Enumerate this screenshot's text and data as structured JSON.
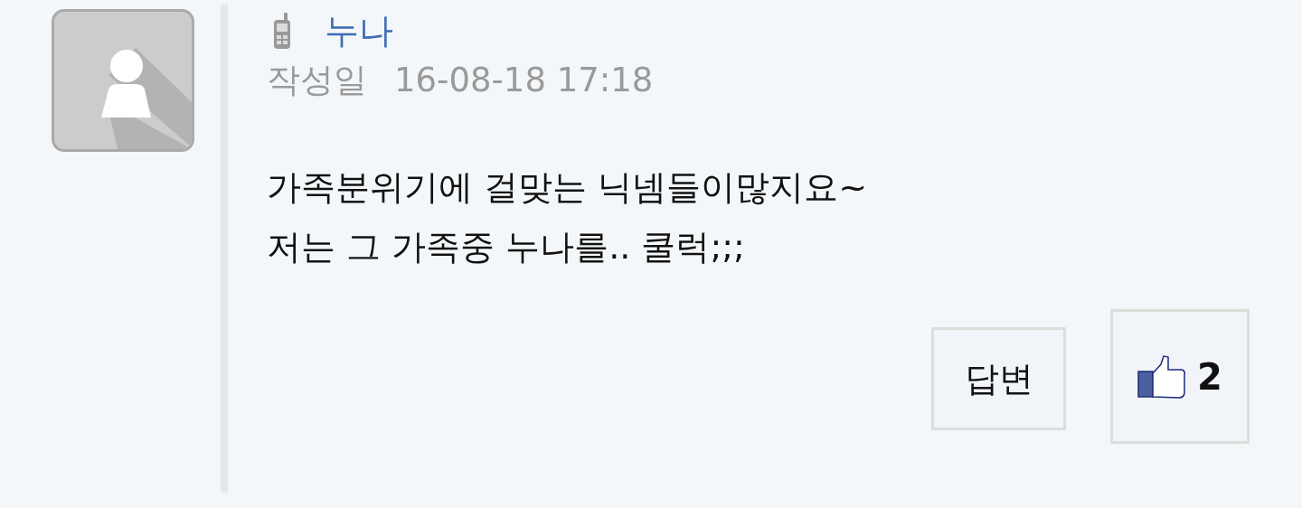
{
  "comment": {
    "author": "누나",
    "date_label": "작성일",
    "date": "16-08-18 17:18",
    "text": "가족분위기에 걸맞는 닉넴들이많지요~\n저는 그 가족중 누나를.. 쿨럭;;;",
    "reply_button": "답변",
    "like_count": "2"
  }
}
